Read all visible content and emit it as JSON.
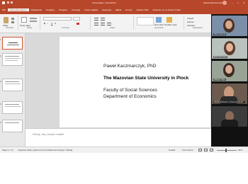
{
  "window": {
    "doc_title": "Prezentacja - PowerPoint",
    "user": "Paweł Kaczmarczyk"
  },
  "ribbon_tabs": [
    "Plik",
    "Narzędzia główne",
    "Wstawianie",
    "Projektuj",
    "Przejścia",
    "Animacje",
    "Pokaz slajdów",
    "Recenzja",
    "Widok",
    "Pomoc",
    "Pobierz PDF",
    "Powiedz mi, co chcesz zrobić"
  ],
  "ribbon_groups": [
    "Schowek",
    "Slajdy",
    "Czcionka",
    "Akapit",
    "Rysowanie",
    "Edytowanie"
  ],
  "ribbon_buttons": {
    "paste": "Wklej",
    "new_slide": "Nowy slajd",
    "arrange": "Rozmieść",
    "quick_styles": "Szybkie style",
    "find": "Znajdź",
    "replace": "Zamień",
    "select": "Zaznacz"
  },
  "slide": {
    "author": "Paweł Kaczmarczyk, PhD",
    "university": "The Mazovian State University in Plock",
    "faculty": "Faculty of Social Sciences",
    "department": "Department of Economics"
  },
  "notes_placeholder": "Kliknij, aby dodać notatki",
  "status": {
    "slide_info": "Slajd 1 z 12",
    "language": "Angielski (Stany Zjednoczone)",
    "accessibility": "Ułatwienia dostępu: Zbadaj",
    "notes": "Notatki",
    "comments": "Komentarze",
    "zoom": "65%"
  },
  "participants": [
    {
      "name": "Olivia Kraszta"
    },
    {
      "name": "Eliza-Olchowicz"
    },
    {
      "name": "Gładysz Olga"
    },
    {
      "name": "Witold Rutkiewicz (Uniwersytet Łód..."
    },
    {
      "name": ""
    }
  ],
  "colors": {
    "accent": "#b7472a",
    "slide_bg": "#ffffff",
    "workarea_bg": "#d9d9d9"
  }
}
